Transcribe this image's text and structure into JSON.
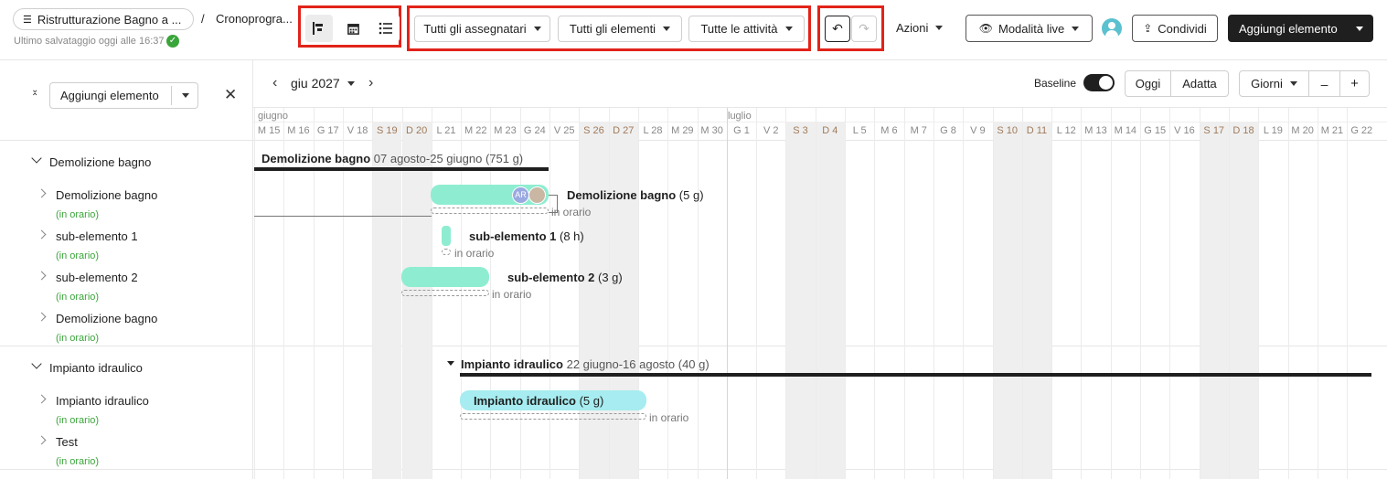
{
  "header": {
    "project_title": "Ristrutturazione Bagno a ...",
    "separator": "/",
    "page_title": "Cronoprogra...",
    "last_saved": "Ultimo salvataggio oggi alle 16:37",
    "filters": {
      "assignees": "Tutti gli assegnatari",
      "elements": "Tutti gli elementi",
      "activities": "Tutte le attività"
    },
    "actions_label": "Azioni",
    "live_mode_label": "Modalità live",
    "share_label": "Condividi",
    "add_element_label": "Aggiungi elemento"
  },
  "sidebar": {
    "add_element_label": "Aggiungi elemento",
    "groups": [
      {
        "title": "Demolizione bagno",
        "items": [
          {
            "label": "Demolizione bagno",
            "status": "(in orario)"
          },
          {
            "label": "sub-elemento 1",
            "status": "(in orario)"
          },
          {
            "label": "sub-elemento 2",
            "status": "(in orario)"
          },
          {
            "label": "Demolizione bagno",
            "status": "(in orario)"
          }
        ]
      },
      {
        "title": "Impianto idraulico",
        "items": [
          {
            "label": "Impianto idraulico",
            "status": "(in orario)"
          },
          {
            "label": "Test",
            "status": "(in orario)"
          }
        ]
      }
    ]
  },
  "timeline": {
    "month_selector": "giu 2027",
    "baseline_label": "Baseline",
    "today_label": "Oggi",
    "fit_label": "Adatta",
    "scale_label": "Giorni",
    "zoom_out": "–",
    "zoom_in": "+",
    "months": [
      {
        "label": "giugno"
      },
      {
        "label": "luglio"
      }
    ],
    "days": [
      "M 15",
      "M 16",
      "G 17",
      "V 18",
      "S 19",
      "D 20",
      "L 21",
      "M 22",
      "M 23",
      "G 24",
      "V 25",
      "S 26",
      "D 27",
      "L 28",
      "M 29",
      "M 30",
      "G 1",
      "V 2",
      "S 3",
      "D 4",
      "L 5",
      "M 6",
      "M 7",
      "G 8",
      "V 9",
      "S 10",
      "D 11",
      "L 12",
      "M 13",
      "M 14",
      "G 15",
      "V 16",
      "S 17",
      "D 18",
      "L 19",
      "M 20",
      "M 21",
      "G 22"
    ],
    "weekend_days": [
      4,
      5,
      11,
      12,
      18,
      19,
      25,
      26,
      32,
      33
    ],
    "group1": {
      "title": "Demolizione bagno",
      "range": "07 agosto-25 giugno (751 g)"
    },
    "task1": {
      "name": "Demolizione bagno",
      "duration": "(5 g)",
      "status": "in orario",
      "avatar_initials": "AR"
    },
    "task2": {
      "name": "sub-elemento 1",
      "duration": "(8 h)",
      "status": "in orario"
    },
    "task3": {
      "name": "sub-elemento 2",
      "duration": "(3 g)",
      "status": "in orario"
    },
    "group2": {
      "title": "Impianto idraulico",
      "range": "22 giugno-16 agosto (40 g)"
    },
    "task4": {
      "name": "Impianto idraulico",
      "duration": "(5 g)",
      "status": "in orario"
    }
  },
  "colors": {
    "accent_dark": "#1f1f1f",
    "bar_green": "#8eedd1",
    "bar_cyan": "#a6ecf0",
    "status_green": "#3aa53a",
    "highlight_red": "#e2231a"
  }
}
